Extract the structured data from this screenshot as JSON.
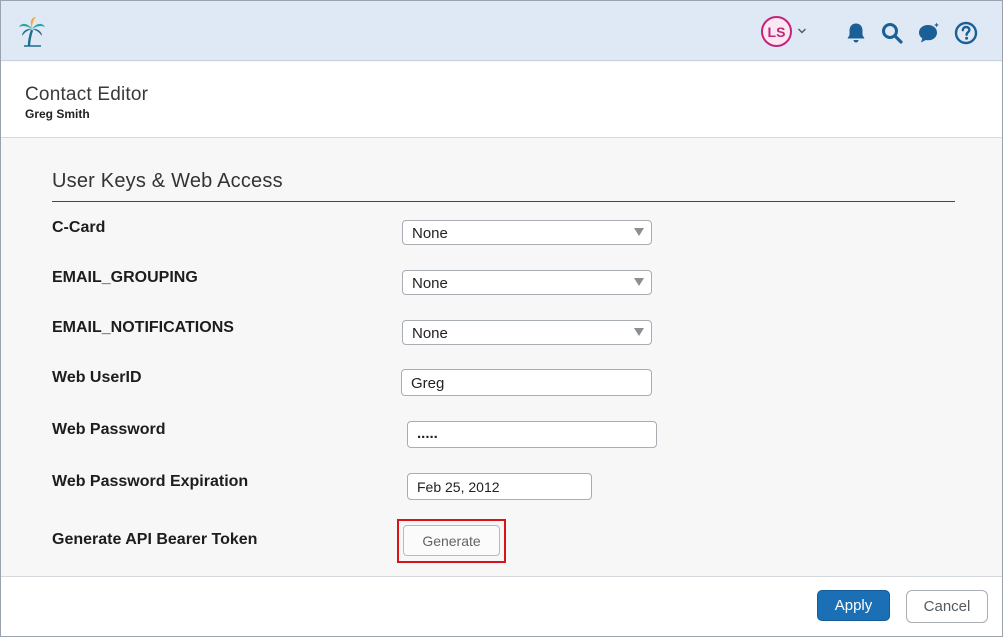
{
  "topbar": {
    "logo_icon": "palm-tree-logo",
    "avatar_initials": "LS",
    "icons": [
      "bell-icon",
      "search-icon",
      "chat-sparkle-icon",
      "help-icon"
    ],
    "accent_color": "#1b6fb4",
    "avatar_color": "#c2267a"
  },
  "header": {
    "title": "Contact Editor",
    "subtitle": "Greg Smith"
  },
  "section": {
    "title": "User Keys & Web Access"
  },
  "fields": {
    "c_card": {
      "label": "C-Card",
      "value": "None"
    },
    "email_grouping": {
      "label": "EMAIL_GROUPING",
      "value": "None"
    },
    "email_notifications": {
      "label": "EMAIL_NOTIFICATIONS",
      "value": "None"
    },
    "web_userid": {
      "label": "Web UserID",
      "value": "Greg"
    },
    "web_password": {
      "label": "Web Password",
      "value": "....."
    },
    "web_password_expiration": {
      "label": "Web Password Expiration",
      "value": "Feb 25, 2012"
    },
    "api_token": {
      "label": "Generate API Bearer Token",
      "button": "Generate"
    }
  },
  "footer": {
    "apply_label": "Apply",
    "cancel_label": "Cancel"
  }
}
